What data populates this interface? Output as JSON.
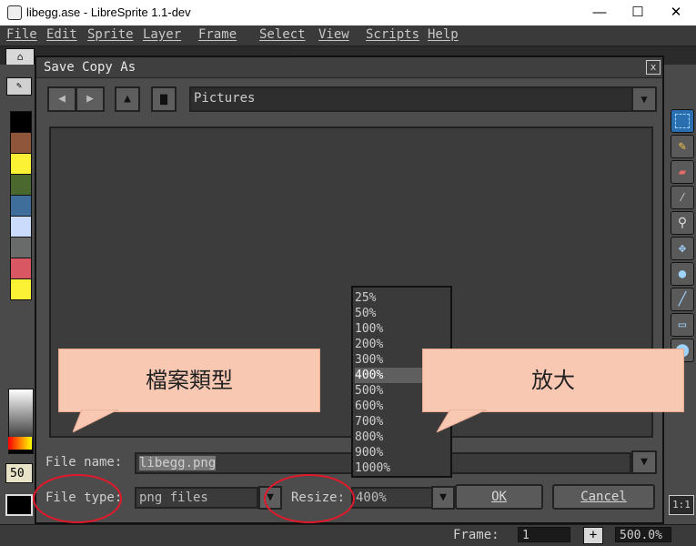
{
  "window": {
    "title": "libegg.ase - LibreSprite 1.1-dev",
    "minimize": "—",
    "maximize": "☐",
    "close": "✕"
  },
  "menu": [
    "File",
    "Edit",
    "Sprite",
    "Layer",
    "Frame",
    "Select",
    "View",
    "Scripts",
    "Help"
  ],
  "left_panel": {
    "zoom_partial": "50"
  },
  "palette_colors": [
    "#000000",
    "#8f563b",
    "#fbf236",
    "#4b692f",
    "#3f6e9a",
    "#cbdbfc",
    "#696a6a",
    "#d95763",
    "#fbf236"
  ],
  "dialog": {
    "title": "Save Copy As",
    "close_glyph": "x",
    "location": "Pictures",
    "file_name_label": "File name:",
    "file_name_value": "libegg.png",
    "file_type_label": "File type:",
    "file_type_value": "png files",
    "resize_label": "Resize:",
    "resize_value": "400%",
    "ok_label": "OK",
    "cancel_label": "Cancel",
    "resize_options": [
      "25%",
      "50%",
      "100%",
      "200%",
      "300%",
      "400%",
      "500%",
      "600%",
      "700%",
      "800%",
      "900%",
      "1000%"
    ],
    "resize_selected": "400%"
  },
  "annotations": {
    "file_type_callout": "檔案類型",
    "resize_callout": "放大",
    "annotation_color": "#e0192b",
    "callout_color": "#f8c8b3"
  },
  "status": {
    "frame_label": "Frame:",
    "frame_value": "1",
    "plus": "+",
    "zoom_value": "500.0%"
  },
  "right_panel": {
    "ratio_label": "1:1"
  }
}
